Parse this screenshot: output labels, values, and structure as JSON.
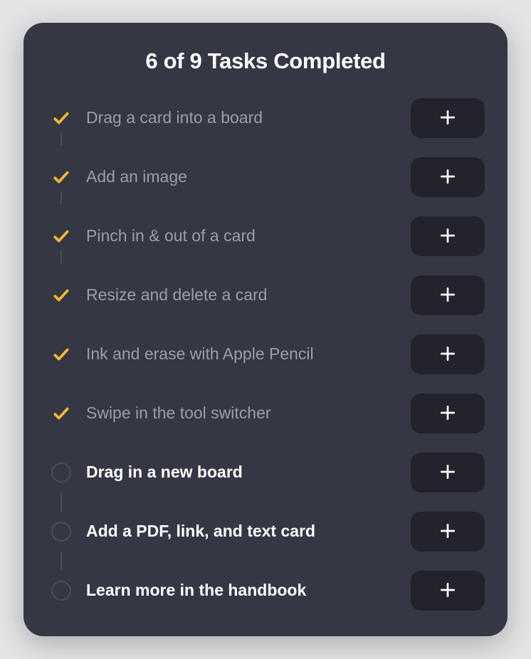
{
  "title": "6 of 9 Tasks Completed",
  "tasks": [
    {
      "label": "Drag a card into a board",
      "completed": true
    },
    {
      "label": "Add an image",
      "completed": true
    },
    {
      "label": "Pinch in & out of a card",
      "completed": true
    },
    {
      "label": "Resize and delete a card",
      "completed": true
    },
    {
      "label": "Ink and erase with Apple Pencil",
      "completed": true
    },
    {
      "label": "Swipe in the tool switcher",
      "completed": true
    },
    {
      "label": "Drag in a new board",
      "completed": false
    },
    {
      "label": "Add a PDF, link, and text card",
      "completed": false
    },
    {
      "label": "Learn more in the handbook",
      "completed": false
    }
  ]
}
